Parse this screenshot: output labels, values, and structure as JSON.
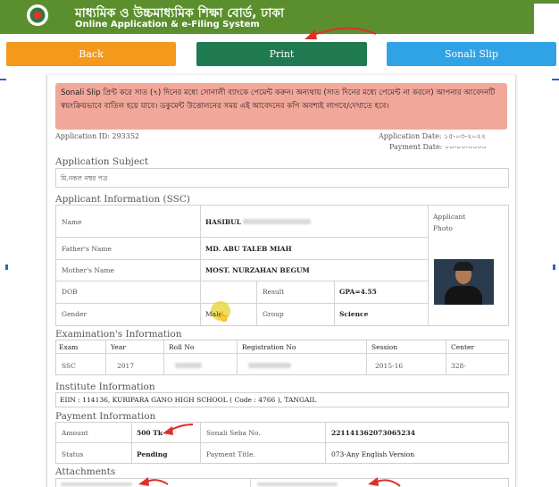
{
  "header": {
    "title_bn": "মাধ্যমিক ও উচ্চমাধ্যমিক শিক্ষা বোর্ড, ঢাকা",
    "title_en": "Online Application & e-Filing System"
  },
  "buttons": {
    "back": "Back",
    "print": "Print",
    "sonali": "Sonali Slip"
  },
  "notice": "Sonali Slip প্রিন্ট করে সাত (৭) দিনের মধ্যে সোনালী ব্যাংকে পেমেন্ট করুন। অন্যথায় (সাত দিনের মধ্যে পেমেন্ট না করলে) আপনার আবেদনটি স্বয়ংক্রিয়ভাবে বাতিল হয়ে যাবে। ডকুমেন্ট উত্তোলনের সময় এই আবেদনের কপি অবশ্যই লাগবে/দেখাতে হবে।",
  "application": {
    "id_label": "Application ID: 293352",
    "date_label": "Application Date: ১৫-০৩-২০২২",
    "payment_date_label": "Payment Date: ০০-০০-০০০০"
  },
  "sections": {
    "subject": "Application Subject",
    "applicant": "Applicant Information (SSC)",
    "exam": "Examination's Information",
    "institute": "Institute Information",
    "payment": "Payment Information",
    "attachments": "Attachments"
  },
  "subject_value": "মি.নকল নম্বর পত্র",
  "applicant": {
    "name_label": "Name",
    "name_value": "HASIBUL",
    "photo_label": "Applicant Photo",
    "father_label": "Father's Name",
    "father_value": "MD. ABU TALEB MIAH",
    "mother_label": "Mother's Name",
    "mother_value": "MOST. NURZAHAN BEGUM",
    "dob_label": "DOB",
    "result_label": "Result",
    "result_value": "GPA=4.55",
    "gender_label": "Gender",
    "gender_value": "Male",
    "group_label": "Group",
    "group_value": "Science"
  },
  "exam": {
    "headers": [
      "Exam",
      "Year",
      "Roll No",
      "Registration No",
      "Session",
      "Center"
    ],
    "row": [
      "SSC",
      "2017",
      "",
      "",
      "2015-16",
      "328-"
    ]
  },
  "institute_value": "EIIN : 114136, KURIPARA GANO HIGH SCHOOL ( Code : 4766 ), TANGAIL",
  "payment": {
    "amount_label": "Amount",
    "amount_value": "500 Tk",
    "seba_label": "Sonali Seba No.",
    "seba_value": "221141362073065234",
    "status_label": "Status",
    "status_value": "Pending",
    "title_label": "Payment Title.",
    "title_value": "073-Any English Version"
  },
  "colors": {
    "header_green": "#5b8f2e",
    "back_orange": "#f4991c",
    "print_green": "#1f7a52",
    "sonali_blue": "#2fa3e6",
    "notice_pink": "#f2a79b",
    "arrow_red": "#e0302a"
  }
}
